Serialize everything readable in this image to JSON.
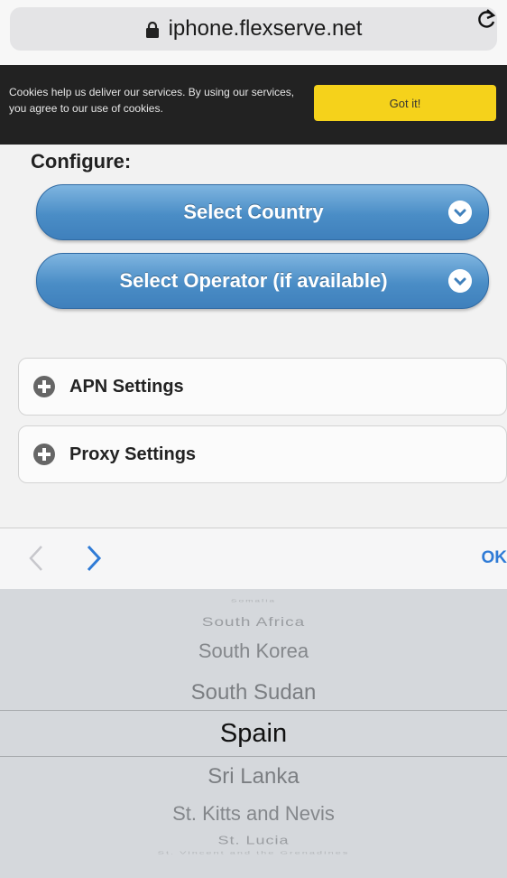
{
  "browser": {
    "url": "iphone.flexserve.net",
    "lock_icon": "lock-icon",
    "reload_icon": "reload-icon"
  },
  "cookie_banner": {
    "text": "Cookies help us deliver our services. By using our services, you agree to our use of cookies.",
    "button": "Got it!"
  },
  "configure": {
    "title": "Configure:",
    "select_country": "Select Country",
    "select_operator": "Select Operator (if available)"
  },
  "sections": [
    {
      "label": "APN Settings"
    },
    {
      "label": "Proxy Settings"
    }
  ],
  "toolbar": {
    "ok_label": "OK"
  },
  "picker": {
    "items": [
      "Somalia",
      "South Africa",
      "South Korea",
      "South Sudan",
      "Spain",
      "Sri Lanka",
      "St. Kitts and Nevis",
      "St. Lucia",
      "St. Vincent and the Grenadines"
    ],
    "selected": "Spain"
  }
}
